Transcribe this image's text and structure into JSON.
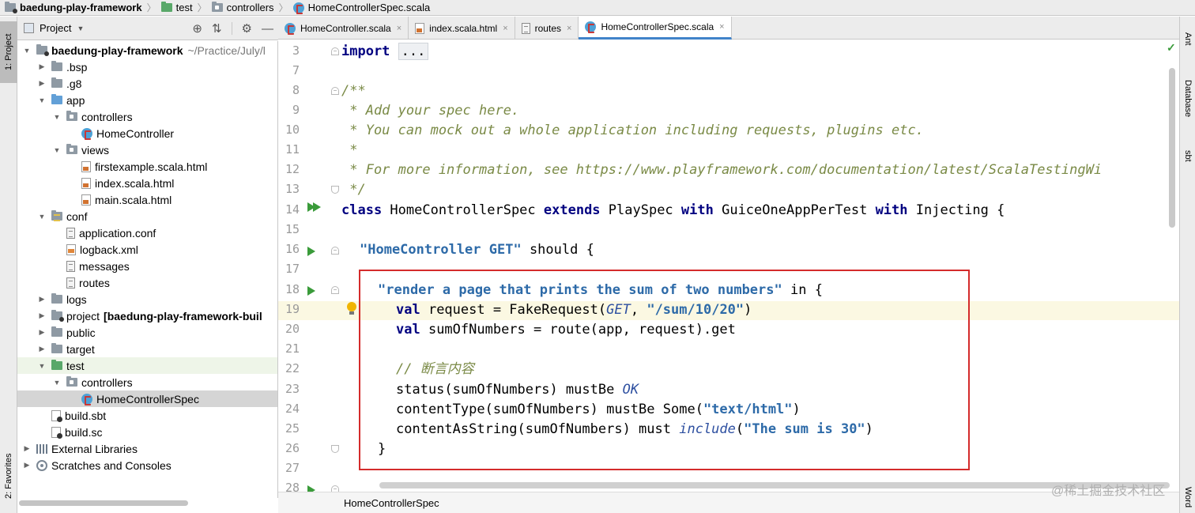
{
  "breadcrumb": [
    "baedung-play-framework",
    "test",
    "controllers",
    "HomeControllerSpec.scala"
  ],
  "left_strip": {
    "project_tab": "1: Project",
    "favorites_tab": "2: Favorites"
  },
  "right_strip": {
    "ant": "Ant",
    "database": "Database",
    "sbt": "sbt",
    "word": "Word"
  },
  "project_panel": {
    "title": "Project",
    "icons": [
      "target-icon",
      "collapse-icon",
      "gear-icon",
      "minimize-icon"
    ]
  },
  "tree": [
    {
      "label": "baedung-play-framework",
      "suffix": "~/Practice/July/l",
      "depth": 0,
      "expanded": true,
      "icon": "folder-module",
      "bold": true
    },
    {
      "label": ".bsp",
      "depth": 1,
      "expanded": false,
      "icon": "folder"
    },
    {
      "label": ".g8",
      "depth": 1,
      "expanded": false,
      "icon": "folder"
    },
    {
      "label": "app",
      "depth": 1,
      "expanded": true,
      "icon": "folder-blue"
    },
    {
      "label": "controllers",
      "depth": 2,
      "expanded": true,
      "icon": "folder-package"
    },
    {
      "label": "HomeController",
      "depth": 3,
      "icon": "scala-class"
    },
    {
      "label": "views",
      "depth": 2,
      "expanded": true,
      "icon": "folder-package"
    },
    {
      "label": "firstexample.scala.html",
      "depth": 3,
      "icon": "html-file"
    },
    {
      "label": "index.scala.html",
      "depth": 3,
      "icon": "html-file"
    },
    {
      "label": "main.scala.html",
      "depth": 3,
      "icon": "html-file"
    },
    {
      "label": "conf",
      "depth": 1,
      "expanded": true,
      "icon": "folder-resources"
    },
    {
      "label": "application.conf",
      "depth": 2,
      "icon": "text-file"
    },
    {
      "label": "logback.xml",
      "depth": 2,
      "icon": "xml-file"
    },
    {
      "label": "messages",
      "depth": 2,
      "icon": "text-file"
    },
    {
      "label": "routes",
      "depth": 2,
      "icon": "text-file"
    },
    {
      "label": "logs",
      "depth": 1,
      "expanded": false,
      "icon": "folder"
    },
    {
      "label": "project",
      "suffix_bold": "[baedung-play-framework-buil",
      "depth": 1,
      "expanded": false,
      "icon": "folder-module"
    },
    {
      "label": "public",
      "depth": 1,
      "expanded": false,
      "icon": "folder"
    },
    {
      "label": "target",
      "depth": 1,
      "expanded": false,
      "icon": "folder"
    },
    {
      "label": "test",
      "depth": 1,
      "expanded": true,
      "icon": "folder-green"
    },
    {
      "label": "controllers",
      "depth": 2,
      "expanded": true,
      "icon": "folder-package"
    },
    {
      "label": "HomeControllerSpec",
      "depth": 3,
      "icon": "scala-class",
      "selected": true
    },
    {
      "label": "build.sbt",
      "depth": 1,
      "icon": "sbt-file"
    },
    {
      "label": "build.sc",
      "depth": 1,
      "icon": "sbt-file"
    },
    {
      "label": "External Libraries",
      "depth": 0,
      "expanded": false,
      "icon": "library"
    },
    {
      "label": "Scratches and Consoles",
      "depth": 0,
      "expanded": false,
      "icon": "scratch"
    }
  ],
  "tabs": [
    {
      "label": "HomeController.scala",
      "icon": "scala-class",
      "active": false
    },
    {
      "label": "index.scala.html",
      "icon": "html-file",
      "active": false
    },
    {
      "label": "routes",
      "icon": "text-file",
      "active": false
    },
    {
      "label": "HomeControllerSpec.scala",
      "icon": "scala-class",
      "active": true
    }
  ],
  "close_glyph": "×",
  "line_numbers": [
    "3",
    "7",
    "8",
    "9",
    "10",
    "11",
    "12",
    "13",
    "14",
    "15",
    "16",
    "17",
    "18",
    "19",
    "20",
    "21",
    "22",
    "23",
    "24",
    "25",
    "26",
    "27",
    "28"
  ],
  "code": {
    "l3_import": "import",
    "l3_fold": "...",
    "l8": "/**",
    "l9": " * Add your spec here.",
    "l10": " * You can mock out a whole application including requests, plugins etc.",
    "l11": " *",
    "l12": " * For more information, see https://www.playframework.com/documentation/latest/ScalaTestingWi",
    "l13": " */",
    "l14_class": "class",
    "l14_name": " HomeControllerSpec ",
    "l14_extends": "extends",
    "l14_base": " PlaySpec ",
    "l14_with1": "with",
    "l14_trait1": " GuiceOneAppPerTest ",
    "l14_with2": "with",
    "l14_trait2": " Injecting {",
    "l16_str": "\"HomeController GET\"",
    "l16_rest": " should {",
    "l18_str": "\"render a page that prints the sum of two numbers\"",
    "l18_rest": " in {",
    "l19_val": "val",
    "l19_a": " request = FakeRequest(",
    "l19_get": "GET",
    "l19_b": ", ",
    "l19_str": "\"/sum/10/20\"",
    "l19_c": ")",
    "l20_val": "val",
    "l20_rest": " sumOfNumbers = route(app, request).get",
    "l22": "// 断言内容",
    "l23_a": "status(sumOfNumbers) mustBe ",
    "l23_ok": "OK",
    "l24_a": "contentType(sumOfNumbers) mustBe Some(",
    "l24_str": "\"text/html\"",
    "l24_b": ")",
    "l25_a": "contentAsString(sumOfNumbers) must ",
    "l25_inc": "include",
    "l25_b": "(",
    "l25_str": "\"The sum is 30\"",
    "l25_c": ")",
    "l26": "}"
  },
  "status_bar": {
    "breadcrumb": "HomeControllerSpec"
  },
  "watermark": "@稀土掘金技术社区",
  "colors": {
    "highlight_box": "#d42b2b",
    "keyword": "#000080",
    "string": "#2d6aa8",
    "comment": "#7a8a46",
    "current_line": "#fbf8e2"
  }
}
